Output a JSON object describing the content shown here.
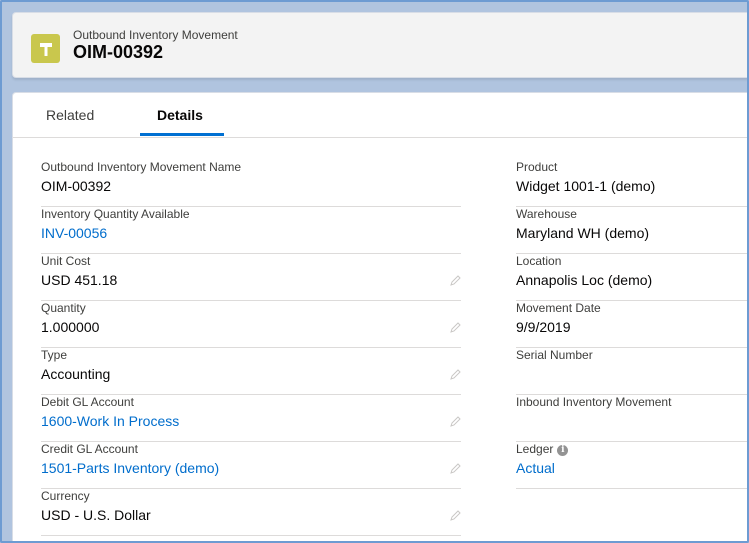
{
  "header": {
    "object_label": "Outbound Inventory Movement",
    "record_name": "OIM-00392"
  },
  "tabs": [
    {
      "label": "Related",
      "active": false
    },
    {
      "label": "Details",
      "active": true
    }
  ],
  "left_fields": [
    {
      "label": "Outbound Inventory Movement Name",
      "value": "OIM-00392",
      "link": false,
      "editable": false
    },
    {
      "label": "Inventory Quantity Available",
      "value": "INV-00056",
      "link": true,
      "editable": false
    },
    {
      "label": "Unit Cost",
      "value": "USD 451.18",
      "link": false,
      "editable": true
    },
    {
      "label": "Quantity",
      "value": "1.000000",
      "link": false,
      "editable": true
    },
    {
      "label": "Type",
      "value": "Accounting",
      "link": false,
      "editable": true
    },
    {
      "label": "Debit GL Account",
      "value": "1600-Work In Process",
      "link": true,
      "editable": true
    },
    {
      "label": "Credit GL Account",
      "value": "1501-Parts Inventory (demo)",
      "link": true,
      "editable": true
    },
    {
      "label": "Currency",
      "value": "USD - U.S. Dollar",
      "link": false,
      "editable": true
    }
  ],
  "right_fields": [
    {
      "label": "Product",
      "value": "Widget 1001-1 (demo)",
      "link": false
    },
    {
      "label": "Warehouse",
      "value": "Maryland WH (demo)",
      "link": false
    },
    {
      "label": "Location",
      "value": "Annapolis Loc (demo)",
      "link": false
    },
    {
      "label": "Movement Date",
      "value": "9/9/2019",
      "link": false
    },
    {
      "label": "Serial Number",
      "value": "",
      "link": false
    },
    {
      "label": "Inbound Inventory Movement",
      "value": "",
      "link": false
    },
    {
      "label": "Ledger",
      "value": "Actual",
      "link": true,
      "info": "i"
    }
  ],
  "colors": {
    "brand_icon": "#c9c74d",
    "link": "#006dcc",
    "tab_active": "#0070d2",
    "background": "#b0c4df"
  },
  "icons": {
    "record": "hammer-icon",
    "edit": "pencil-icon",
    "info": "info-icon"
  }
}
